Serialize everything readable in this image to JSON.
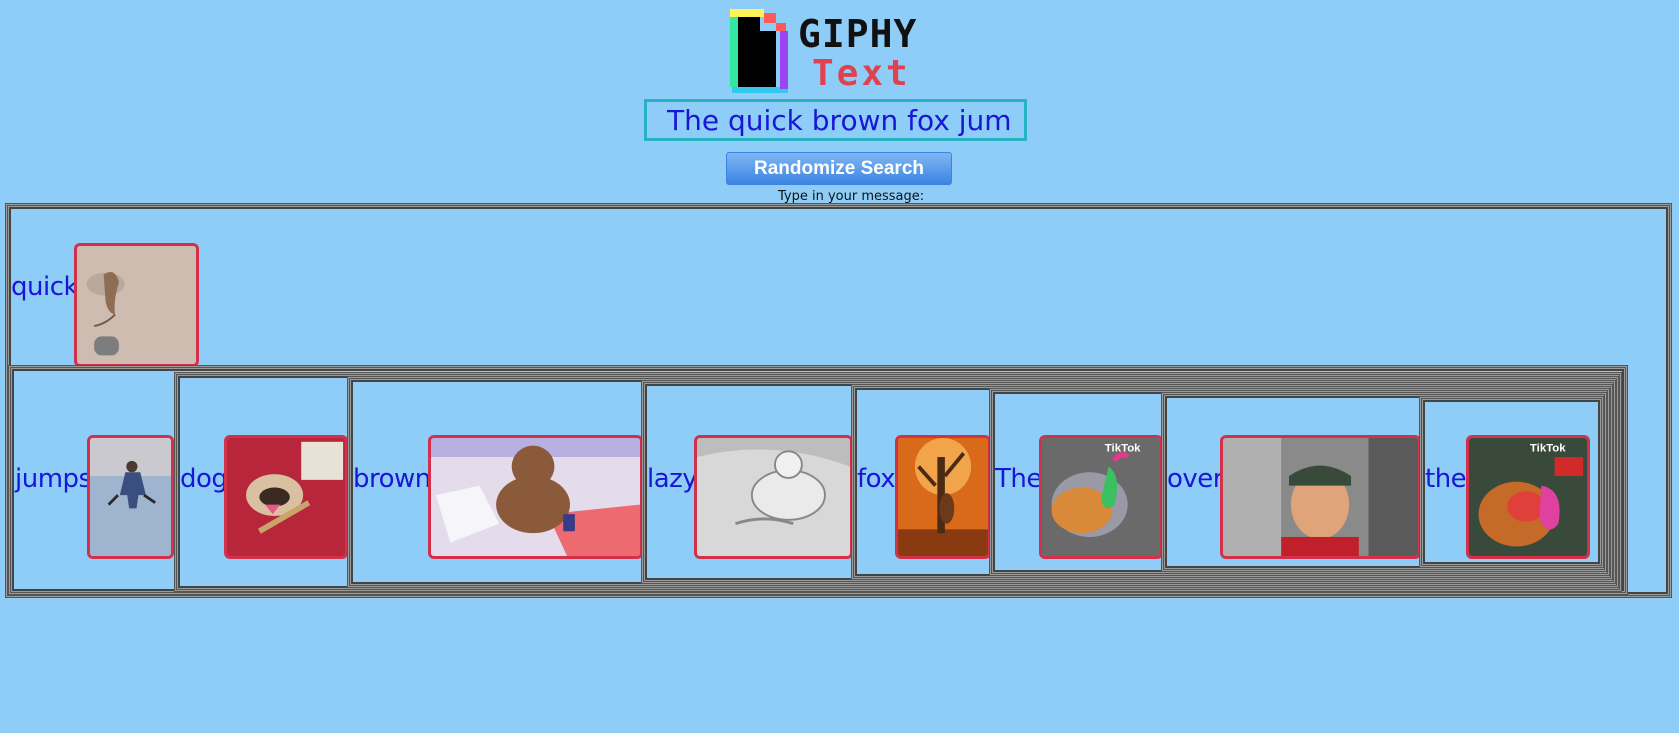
{
  "logo": {
    "line1": "GIPHY",
    "line2": "Text"
  },
  "search": {
    "value": "The quick brown fox jum"
  },
  "randomize_label": "Randomize Search",
  "prompt": "Type in your message:",
  "words": {
    "quick": "quick",
    "jumps": "jumps",
    "dog": "dog",
    "brown": "brown",
    "lazy": "lazy",
    "fox": "fox",
    "the_cap": "The",
    "over": "over",
    "the": "the"
  },
  "watermarks": {
    "tiktok": "TikTok"
  },
  "colors": {
    "background": "#8ecdf8",
    "word": "#1a16d6",
    "gif_border": "#d3304b",
    "button": "#4a8fe6"
  }
}
